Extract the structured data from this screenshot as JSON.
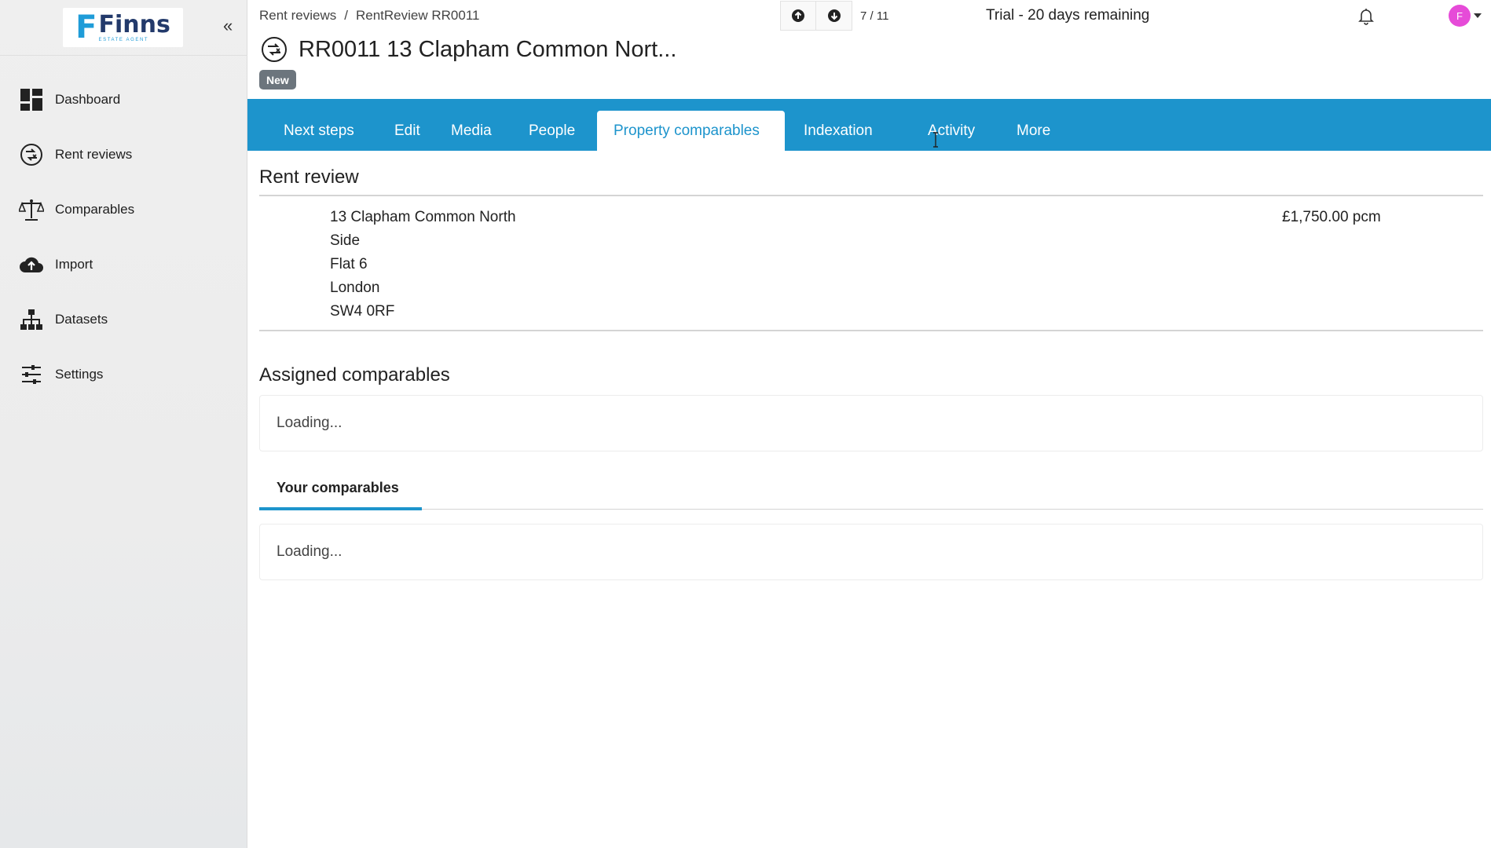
{
  "brand": {
    "logo_letter": "F",
    "logo_name": "Finns",
    "logo_subtitle": "ESTATE AGENT",
    "colors": {
      "primary": "#1d94cc",
      "logo_dark": "#233a6b",
      "badge": "#6c757d",
      "avatar": "#e64bd8"
    }
  },
  "sidebar": {
    "collapse_label": "«",
    "items": [
      {
        "label": "Dashboard",
        "icon": "dashboard-grid-icon"
      },
      {
        "label": "Rent reviews",
        "icon": "rent-review-icon"
      },
      {
        "label": "Comparables",
        "icon": "scales-icon"
      },
      {
        "label": "Import",
        "icon": "cloud-upload-icon"
      },
      {
        "label": "Datasets",
        "icon": "hierarchy-icon"
      },
      {
        "label": "Settings",
        "icon": "sliders-icon"
      }
    ]
  },
  "header": {
    "breadcrumb": {
      "parent": "Rent reviews",
      "separator": "/",
      "current": "RentReview RR0011"
    },
    "pager": {
      "count": "7 / 11"
    },
    "trial": "Trial - 20 days remaining",
    "avatar_initial": "F"
  },
  "record": {
    "title": "RR0011 13 Clapham Common Nort...",
    "status_badge": "New"
  },
  "tabs": [
    {
      "label": "Next steps",
      "active": false
    },
    {
      "label": "Edit",
      "active": false
    },
    {
      "label": "Media",
      "active": false
    },
    {
      "label": "People",
      "active": false
    },
    {
      "label": "Property comparables",
      "active": true
    },
    {
      "label": "Indexation",
      "active": false
    },
    {
      "label": "Activity",
      "active": false
    },
    {
      "label": "More",
      "active": false
    }
  ],
  "rent_review": {
    "heading": "Rent review",
    "address_lines": [
      "13 Clapham Common North",
      "Side",
      "Flat 6",
      "London",
      "SW4 0RF"
    ],
    "price": "£1,750.00 pcm"
  },
  "assigned_comparables": {
    "heading": "Assigned comparables",
    "loading": "Loading..."
  },
  "your_comparables": {
    "tab_label": "Your comparables",
    "loading": "Loading..."
  }
}
